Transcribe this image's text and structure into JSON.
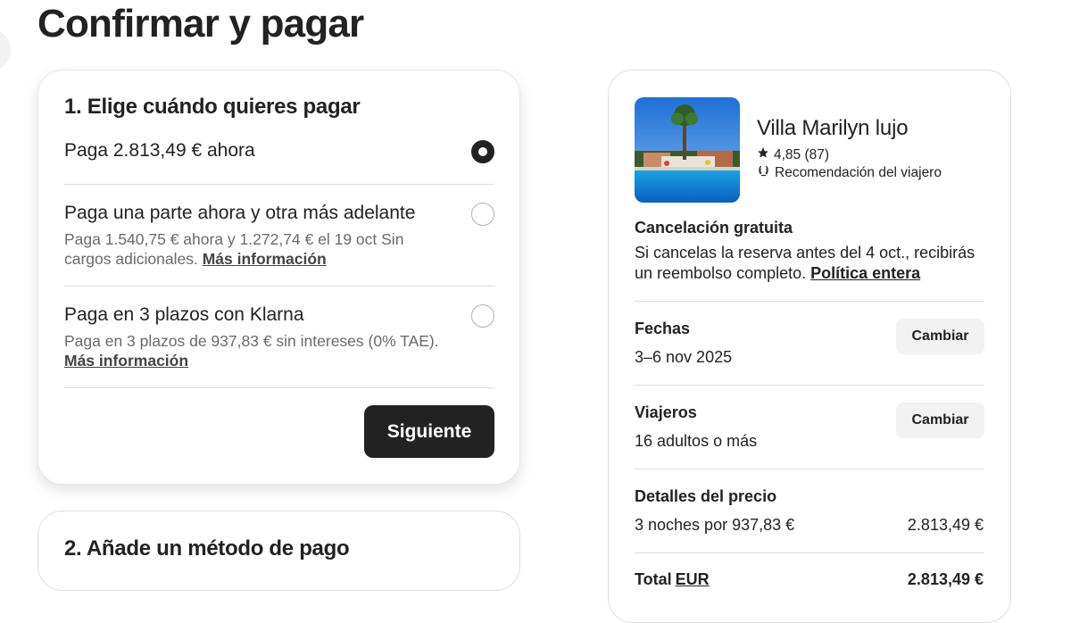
{
  "page": {
    "title": "Confirmar y pagar"
  },
  "payment_timing": {
    "heading": "1. Elige cuándo quieres pagar",
    "options": [
      {
        "title": "Paga 2.813,49 € ahora",
        "selected": true
      },
      {
        "title": "Paga una parte ahora y otra más adelante",
        "subtitle": "Paga 1.540,75 € ahora y 1.272,74 € el 19 oct Sin cargos adicionales.",
        "link": "Más información",
        "selected": false
      },
      {
        "title": "Paga en 3 plazos con Klarna",
        "subtitle": "Paga en 3 plazos de 937,83 € sin intereses (0% TAE).",
        "link": "Más información",
        "selected": false
      }
    ],
    "next_label": "Siguiente"
  },
  "payment_method": {
    "heading": "2. Añade un método de pago"
  },
  "summary": {
    "listing_title": "Villa Marilyn lujo",
    "rating": "4,85 (87)",
    "badge": "Recomendación del viajero",
    "cancellation_title": "Cancelación gratuita",
    "cancellation_text": "Si cancelas la reserva antes del 4 oct., recibirás un reembolso completo.",
    "cancellation_link": "Política entera",
    "dates_label": "Fechas",
    "dates_value": "3–6 nov 2025",
    "guests_label": "Viajeros",
    "guests_value": "16 adultos o más",
    "change_label": "Cambiar",
    "price_details_label": "Detalles del precio",
    "nights_line": "3 noches por 937,83 €",
    "nights_amount": "2.813,49 €",
    "total_label": "Total",
    "currency": "EUR",
    "total_amount": "2.813,49 €"
  },
  "icons": {
    "star": "star-icon",
    "laurel": "laurel-icon"
  },
  "colors": {
    "primary_text": "#222222",
    "secondary_text": "#6a6a6a",
    "button_dark": "#222222",
    "button_light": "#f2f2f2",
    "border": "#dddddd"
  }
}
